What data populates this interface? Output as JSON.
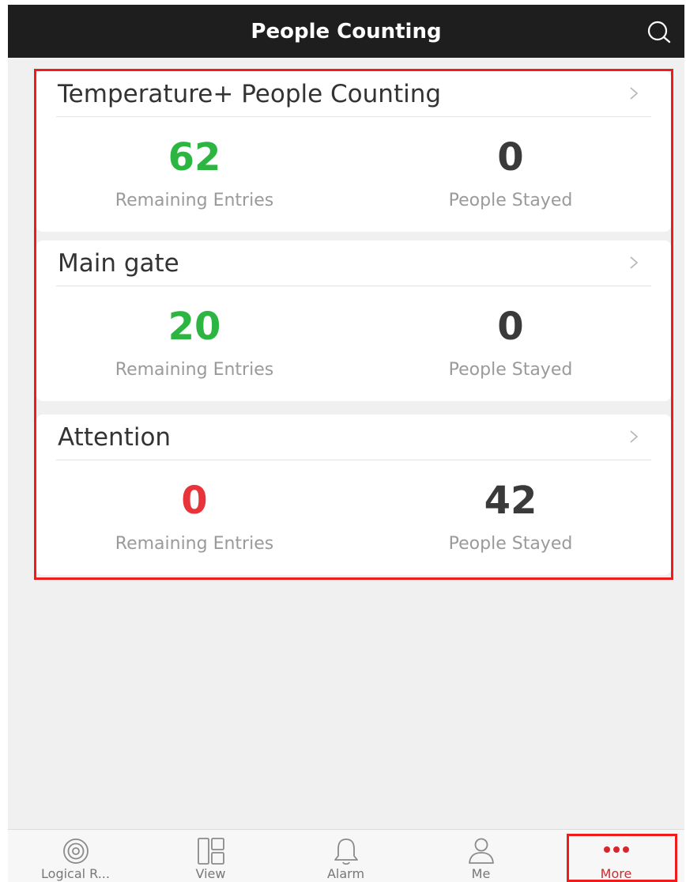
{
  "header": {
    "title": "People Counting",
    "search_icon": "search-icon"
  },
  "colors": {
    "available": "#2db541",
    "full": "#e8333a",
    "neutral": "#3a3a3a",
    "active_tab": "#d9252a",
    "highlight": "#ee1c1c"
  },
  "groups": [
    {
      "name": "Temperature+ People Counting",
      "remaining_entries": "62",
      "remaining_label": "Remaining Entries",
      "people_stayed": "0",
      "stayed_label": "People Stayed",
      "status": "available"
    },
    {
      "name": "Main gate",
      "remaining_entries": "20",
      "remaining_label": "Remaining Entries",
      "people_stayed": "0",
      "stayed_label": "People Stayed",
      "status": "available"
    },
    {
      "name": "Attention",
      "remaining_entries": "0",
      "remaining_label": "Remaining Entries",
      "people_stayed": "42",
      "stayed_label": "People Stayed",
      "status": "full"
    }
  ],
  "tabbar": {
    "items": [
      {
        "label": "Logical R...",
        "icon": "logical-resource-icon",
        "active": false
      },
      {
        "label": "View",
        "icon": "view-layout-icon",
        "active": false
      },
      {
        "label": "Alarm",
        "icon": "bell-icon",
        "active": false
      },
      {
        "label": "Me",
        "icon": "person-icon",
        "active": false
      },
      {
        "label": "More",
        "icon": "more-dots-icon",
        "active": true
      }
    ]
  }
}
